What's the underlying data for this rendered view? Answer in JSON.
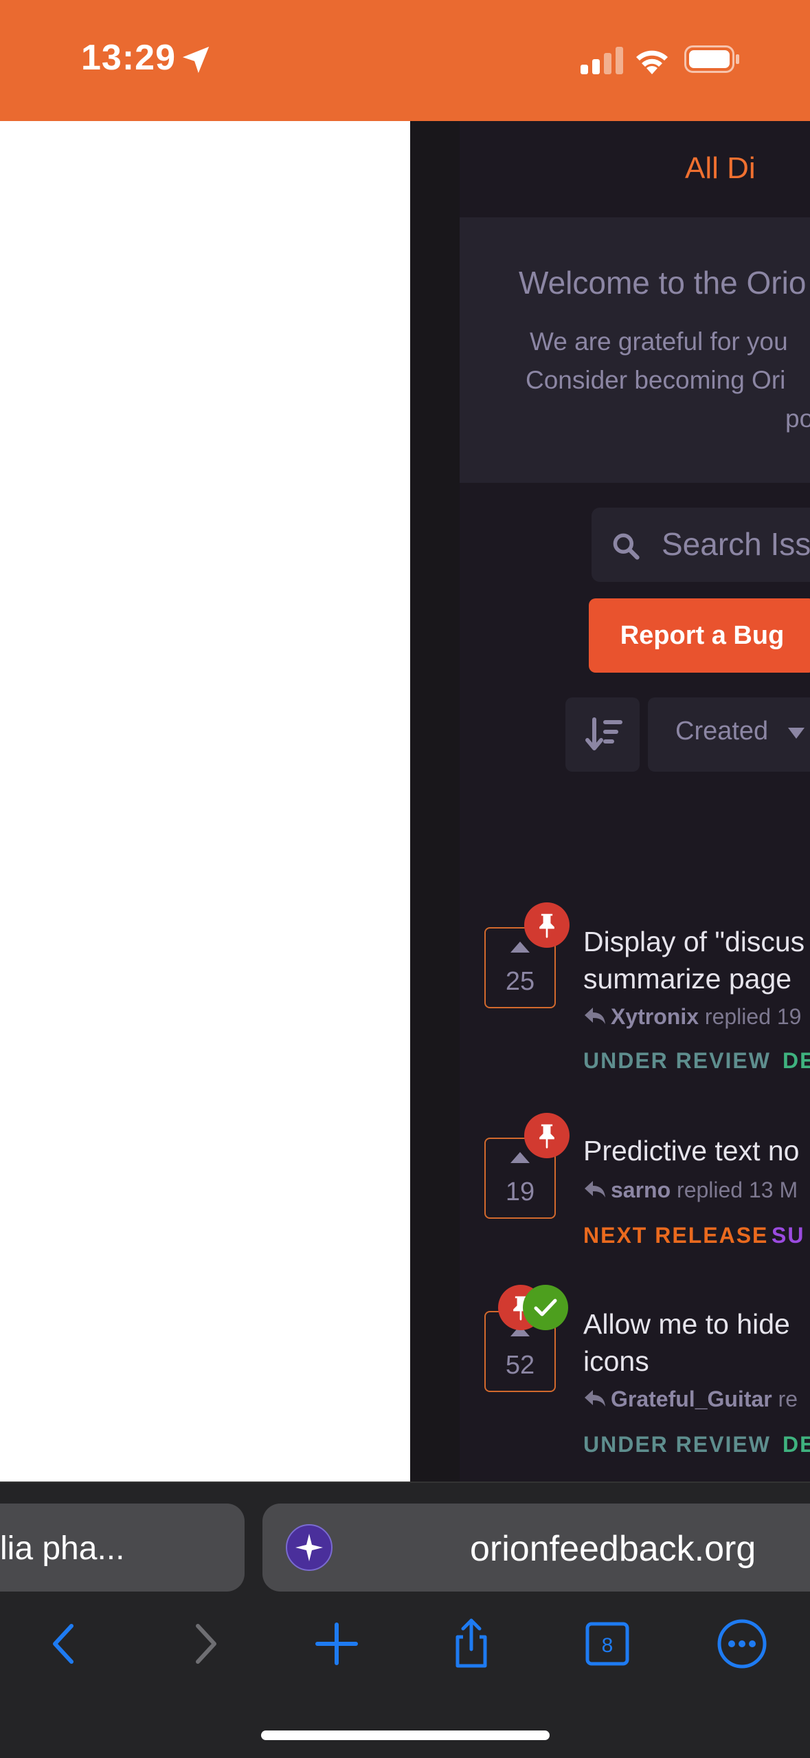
{
  "status_bar": {
    "time": "13:29",
    "location_icon": "location-arrow-icon",
    "signal_icon": "cellular-signal-icon",
    "wifi_icon": "wifi-icon",
    "battery_icon": "battery-icon",
    "color": "#EA6A30"
  },
  "page": {
    "nav_all": "All Di",
    "welcome": {
      "title": "Welcome to the Orio",
      "line1": "We are grateful for you",
      "line2": "Consider becoming Ori",
      "line3": "po"
    },
    "search": {
      "icon": "search-icon",
      "placeholder": "Search Iss"
    },
    "report_button": "Report a Bug",
    "sort": {
      "icon": "sort-descending-icon",
      "selected": "Created"
    },
    "issues": [
      {
        "votes": "25",
        "pinned": true,
        "title_line1": "Display of \"discus",
        "title_line2": "summarize page",
        "author": "Xytronix",
        "meta": "replied 19",
        "tag1": "UNDER REVIEW",
        "tag1_color": "#5E8E8E",
        "tag2": "DE",
        "tag2_color": "#3FB27F"
      },
      {
        "votes": "19",
        "pinned": true,
        "title_line1": "Predictive text no",
        "author": "sarno",
        "meta": "replied 13 M",
        "tag1": "NEXT RELEASE",
        "tag1_color": "#EA6A1E",
        "tag2": "SU",
        "tag2_color": "#9B4BE0"
      },
      {
        "votes": "52",
        "pinned": true,
        "completed": true,
        "title_line1": "Allow me to hide",
        "title_line2": "icons",
        "author": "Grateful_Guitar",
        "meta": "re",
        "tag1": "UNDER REVIEW",
        "tag1_color": "#5E8E8E",
        "tag2": "DE",
        "tag2_color": "#3FB27F"
      }
    ]
  },
  "tabs": {
    "left_label": "lia pha...",
    "right_url": "orionfeedback.org",
    "favicon": "orion-sparkle-icon"
  },
  "toolbar": {
    "back": "back-chevron-icon",
    "forward": "forward-chevron-icon",
    "new_tab": "plus-icon",
    "share": "share-icon",
    "tab_count": "8",
    "more": "more-ellipsis-icon",
    "accent": "#1E7BF2"
  }
}
